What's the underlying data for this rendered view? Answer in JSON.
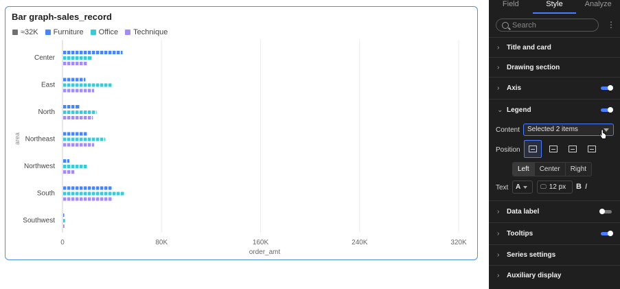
{
  "card": {
    "title": "Bar graph-sales_record",
    "legend": [
      {
        "label": "≈32K",
        "color": "#707070"
      },
      {
        "label": "Furniture",
        "color": "#4a86f0"
      },
      {
        "label": "Office",
        "color": "#3ec9d6"
      },
      {
        "label": "Technique",
        "color": "#a48cf0"
      }
    ]
  },
  "chart_data": {
    "type": "bar",
    "orientation": "horizontal",
    "categories": [
      "Center",
      "East",
      "North",
      "Northeast",
      "Northwest",
      "South",
      "Southwest"
    ],
    "series": [
      {
        "name": "Furniture",
        "color": "#4a86f0",
        "values": [
          48000,
          18000,
          13000,
          20000,
          5000,
          40000,
          500
        ]
      },
      {
        "name": "Office",
        "color": "#3ec9d6",
        "values": [
          23000,
          40000,
          27000,
          34000,
          20000,
          50000,
          1500
        ]
      },
      {
        "name": "Technique",
        "color": "#a48cf0",
        "values": [
          20000,
          25000,
          24000,
          25000,
          9000,
          40000,
          1000
        ]
      }
    ],
    "xlabel": "order_amt",
    "ylabel": "area",
    "x_ticks": [
      "0",
      "80K",
      "160K",
      "240K",
      "320K"
    ],
    "xlim": [
      0,
      320000
    ],
    "grid": "vertical",
    "legend_position": "top-left"
  },
  "panel": {
    "tabs": [
      {
        "label": "Field",
        "active": false
      },
      {
        "label": "Style",
        "active": true
      },
      {
        "label": "Analyze",
        "active": false
      }
    ],
    "search_placeholder": "Search",
    "sections": {
      "title_card": "Title and card",
      "drawing": "Drawing section",
      "axis": "Axis",
      "legend": "Legend",
      "data_label": "Data label",
      "tooltips": "Tooltips",
      "series": "Series settings",
      "auxiliary": "Auxiliary display"
    },
    "legend_opts": {
      "content_label": "Content",
      "content_value": "Selected 2 items",
      "position_label": "Position",
      "align_options": [
        "Left",
        "Center",
        "Right"
      ],
      "align_selected": "Left",
      "text_label": "Text",
      "font_glyph": "A",
      "font_size": "12 px",
      "bold_glyph": "B",
      "italic_glyph": "I"
    },
    "toggles": {
      "axis": true,
      "legend": true,
      "data_label": false,
      "tooltips": true
    }
  }
}
